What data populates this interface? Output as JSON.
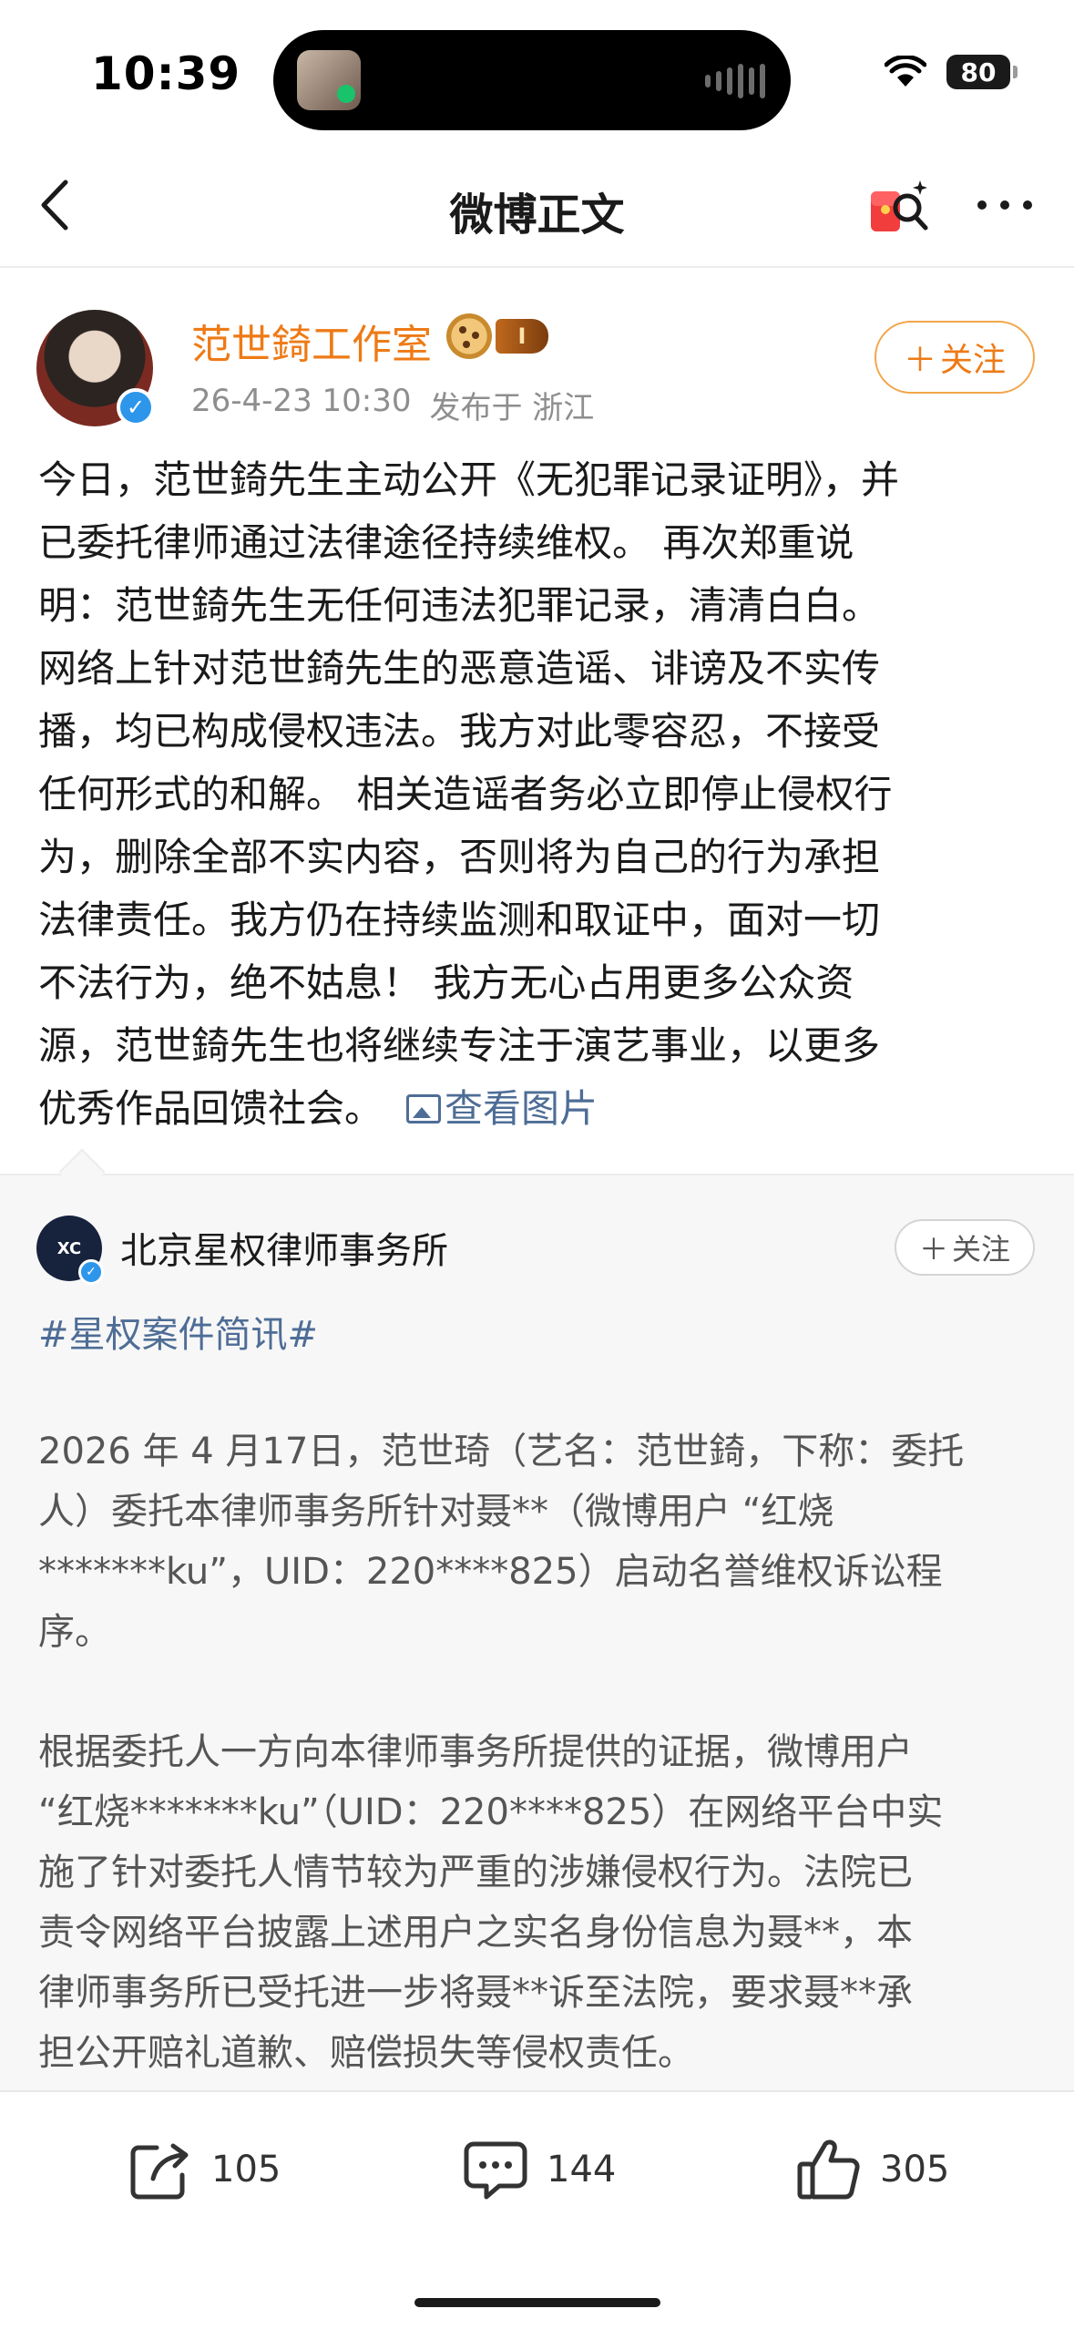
{
  "status_bar": {
    "time": "10:39",
    "battery": "80"
  },
  "nav": {
    "title": "微博正文"
  },
  "post": {
    "author_name": "范世錡工作室",
    "level_badge": "I",
    "timestamp": "26-4-23 10:30",
    "location": "发布于 浙江",
    "follow_label": "关注",
    "text_lines": [
      "今日，范世錡先生主动公开《无犯罪记录证明》，并",
      "已委托律师通过法律途径持续维权。 再次郑重说",
      "明：范世錡先生无任何违法犯罪记录，清清白白。",
      "网络上针对范世錡先生的恶意造谣、诽谤及不实传",
      "播，均已构成侵权违法。我方对此零容忍，不接受",
      "任何形式的和解。 相关造谣者务必立即停止侵权行",
      "为，删除全部不实内容，否则将为自己的行为承担",
      "法律责任。我方仍在持续监测和取证中，面对一切",
      "不法行为，绝不姑息！ 我方无心占用更多公众资",
      "源，范世錡先生也将继续专注于演艺事业，以更多"
    ],
    "last_line": "优秀作品回馈社会。",
    "view_pictures": "查看图片"
  },
  "repost": {
    "author_name": "北京星权律师事务所",
    "avatar_text": "XC",
    "follow_label": "关注",
    "topic": "#星权案件简讯#",
    "para1_lines": [
      "2026 年 4 月17日，范世琦（艺名：范世錡，下称：委托",
      "人）委托本律师事务所针对聂**（微博用户 “红烧",
      "*******ku”，UID：220****825）启动名誉维权诉讼程",
      "序。"
    ],
    "para2_lines": [
      "根据委托人一方向本律师事务所提供的证据，微博用户",
      "“红烧*******ku”（UID：220****825）在网络平台中实",
      "施了针对委托人情节较为严重的涉嫌侵权行为。法院已",
      "责令网络平台披露上述用户之实名身份信息为聂**，本",
      "律师事务所已受托进一步将聂**诉至法院，要求聂**承",
      "担公开赔礼道歉、赔偿损失等侵权责任。"
    ]
  },
  "actions": {
    "repost_count": "105",
    "comment_count": "144",
    "like_count": "305"
  },
  "colors": {
    "accent_orange": "#ee7a16",
    "link_blue": "#4e6d96",
    "verified_blue": "#2d96ea"
  }
}
